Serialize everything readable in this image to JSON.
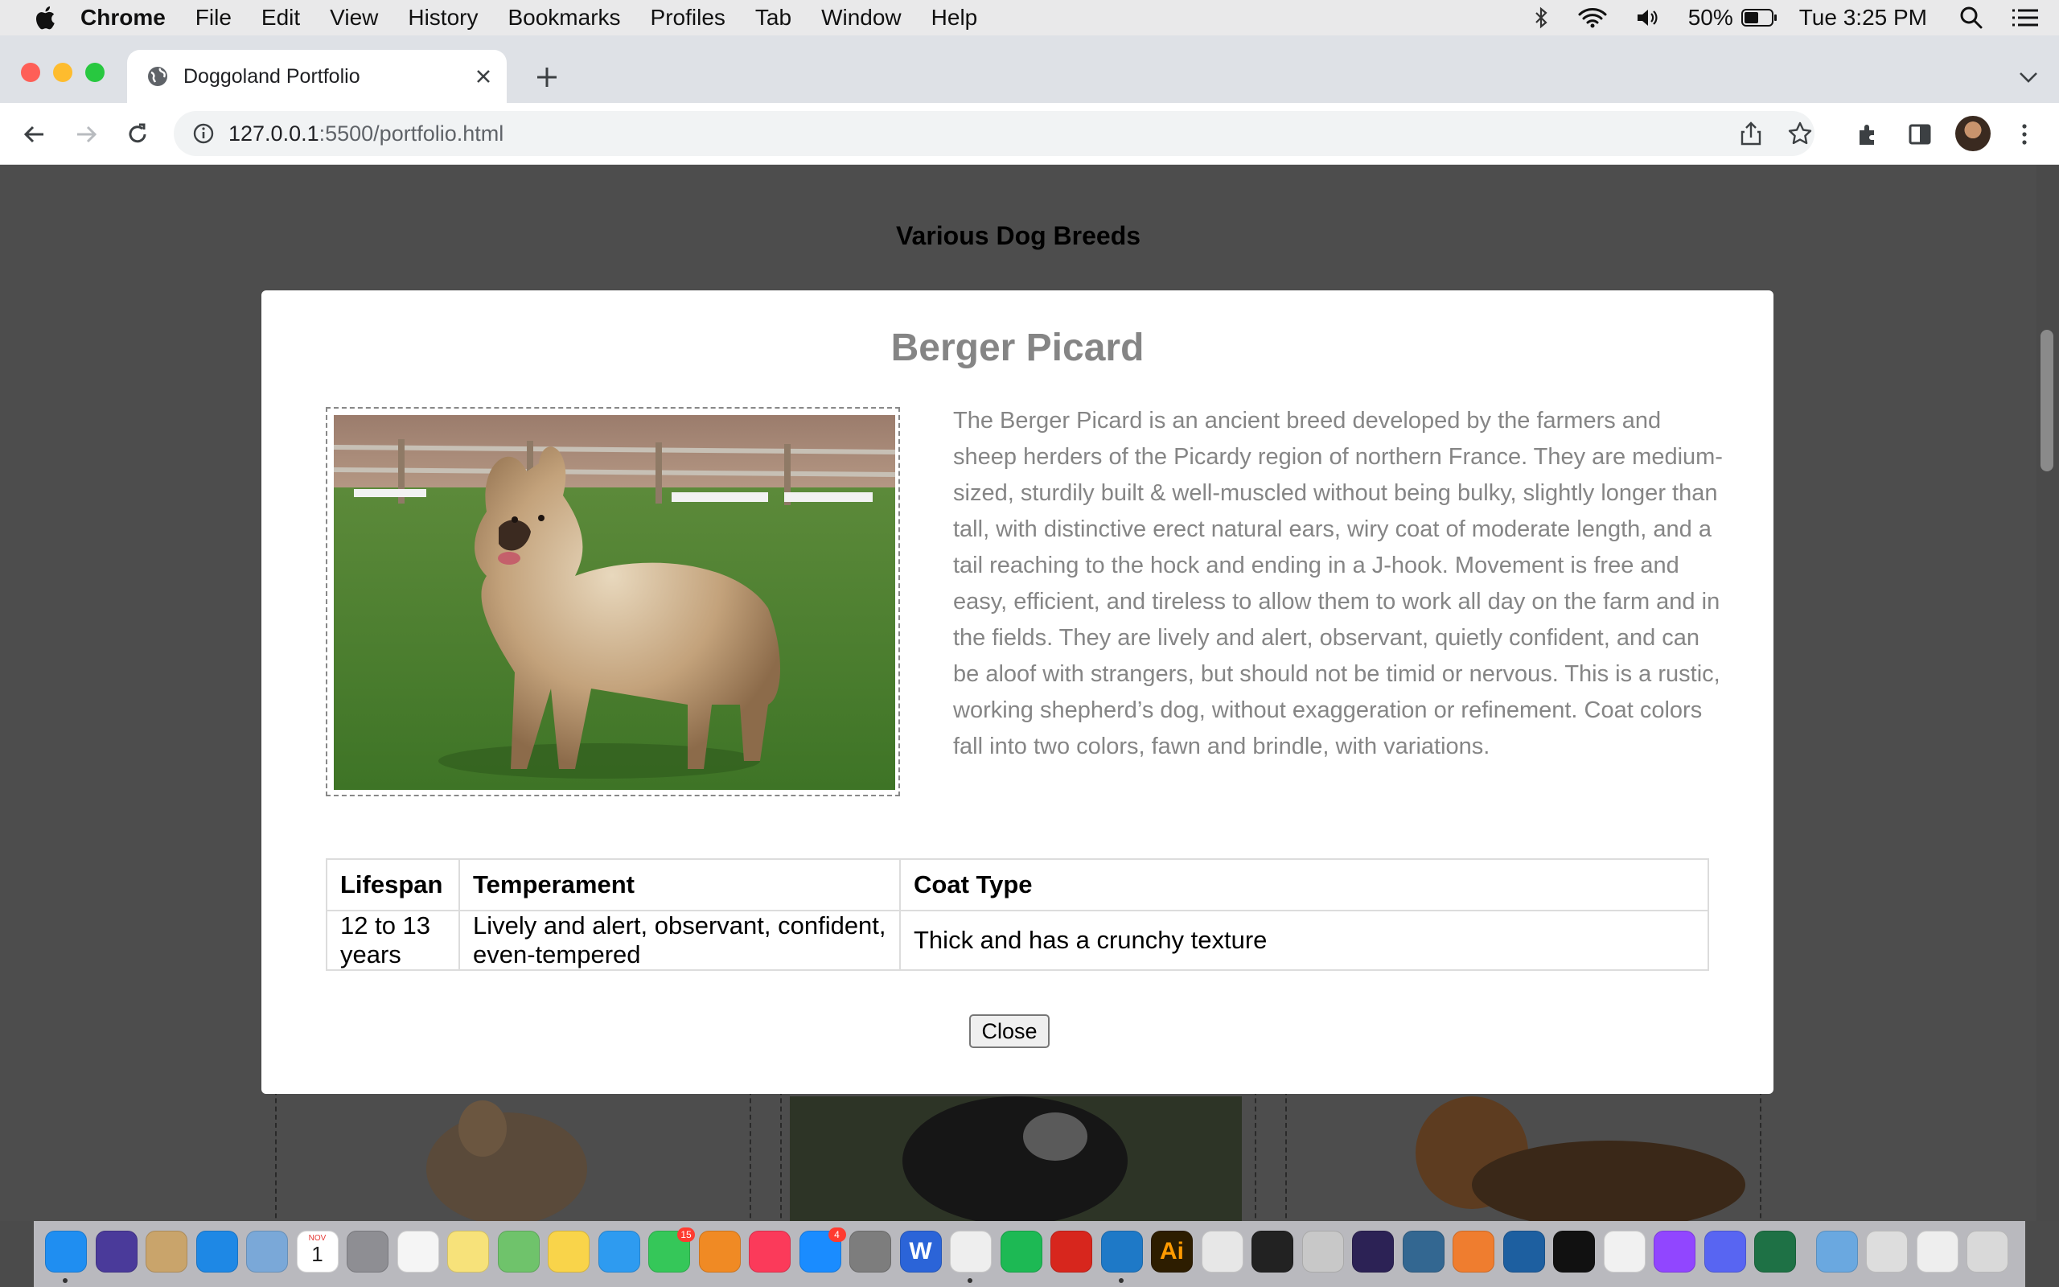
{
  "menubar": {
    "app": "Chrome",
    "items": [
      "File",
      "Edit",
      "View",
      "History",
      "Bookmarks",
      "Profiles",
      "Tab",
      "Window",
      "Help"
    ],
    "battery": "50%",
    "clock": "Tue 3:25 PM"
  },
  "browser": {
    "tab_title": "Doggoland Portfolio",
    "url_host": "127.0.0.1",
    "url_path": ":5500/portfolio.html"
  },
  "page": {
    "heading": "Various Dog Breeds"
  },
  "modal": {
    "title": "Berger Picard",
    "description": "The Berger Picard is an ancient breed developed by the farmers and sheep herders of the Picardy region of northern France. They are medium-sized, sturdily built & well-muscled without being bulky, slightly longer than tall, with distinctive erect natural ears, wiry coat of moderate length, and a tail reaching to the hock and ending in a J-hook. Movement is free and easy, efficient, and tireless to allow them to work all day on the farm and in the fields. They are lively and alert, observant, quietly confident, and can be aloof with strangers, but should not be timid or nervous. This is a rustic, working shepherd’s dog, without exaggeration or refinement. Coat colors fall into two colors, fawn and brindle, with variations.",
    "table": {
      "headers": [
        "Lifespan",
        "Temperament",
        "Coat Type"
      ],
      "row": [
        "12 to 13 years",
        "Lively and alert, observant, confident, even-tempered",
        "Thick and has a crunchy texture"
      ]
    },
    "close_label": "Close"
  },
  "dock": {
    "icons": [
      "finder-icon",
      "siri-icon",
      "notefile-icon",
      "safari-icon",
      "preview-icon",
      "calendar-icon",
      "launchpad-icon",
      "reminders-icon",
      "notes-icon",
      "maps-icon",
      "photos-icon",
      "messages-icon",
      "facetime-icon",
      "books-icon",
      "music-icon",
      "appstore-icon",
      "system-preferences-icon",
      "word-icon",
      "chrome-icon",
      "spotify-icon",
      "acrobat-icon",
      "vscode-icon",
      "illustrator-icon",
      "textedit-icon",
      "terminal-icon",
      "settings-icon",
      "eclipse-icon",
      "postgres-icon",
      "sketch-icon",
      "mysql-workbench-icon",
      "intellij-icon",
      "tableplus-icon",
      "twitch-icon",
      "discord-icon",
      "excel-icon",
      "folder-icon",
      "screenshot-icon",
      "window-icon",
      "trash-icon"
    ],
    "badges": {
      "facetime-icon": "15",
      "appstore-icon": "4"
    },
    "calendar_day": "1",
    "calendar_month": "NOV"
  },
  "colors": {
    "page_bg": "#4d4d4d",
    "modal_text": "#858585",
    "modal_bg": "#ffffff"
  }
}
